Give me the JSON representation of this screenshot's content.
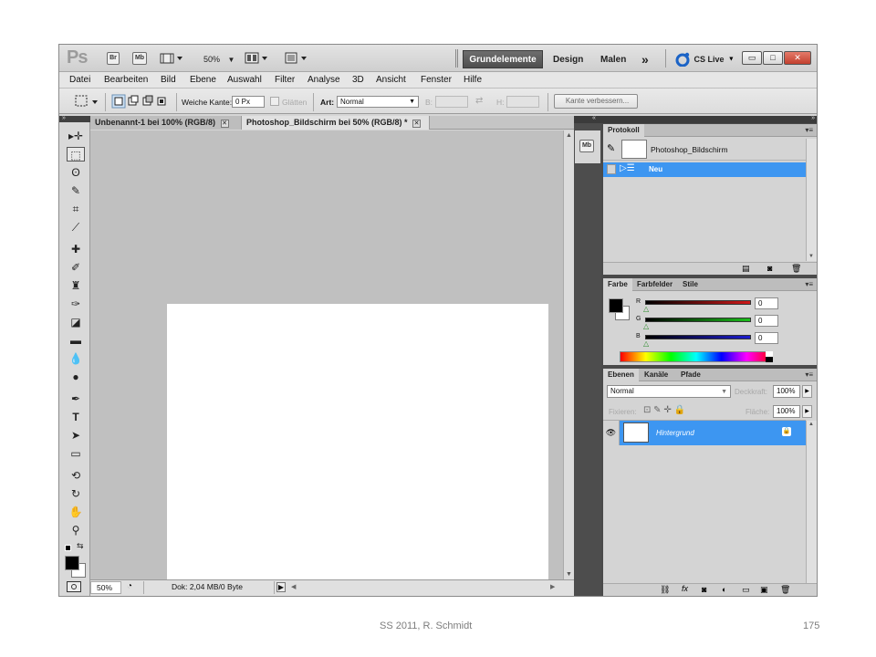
{
  "app": {
    "logo": "Ps",
    "bridge_chip": "Br",
    "minibridge_chip": "Mb",
    "zoom_chip": "50%",
    "workspaces": [
      "Grundelemente",
      "Design",
      "Malen"
    ],
    "more": "»",
    "cs_live": "CS Live",
    "window_buttons": [
      "▭",
      "□",
      "✕"
    ]
  },
  "menu": [
    "Datei",
    "Bearbeiten",
    "Bild",
    "Ebene",
    "Auswahl",
    "Filter",
    "Analyse",
    "3D",
    "Ansicht",
    "Fenster",
    "Hilfe"
  ],
  "options": {
    "feather_label": "Weiche Kante:",
    "feather_value": "0 Px",
    "smooth_label": "Glätten",
    "style_label": "Art:",
    "style_value": "Normal",
    "width_label": "B:",
    "height_label": "H:",
    "refine_button": "Kante verbessern..."
  },
  "documents": {
    "tabs": [
      "Unbenannt-1 bei 100% (RGB/8)",
      "Photoshop_Bildschirm bei 50% (RGB/8) *"
    ],
    "close_glyph": "✕"
  },
  "status": {
    "zoom": "50%",
    "doc_info": "Dok: 2,04 MB/0 Byte"
  },
  "history": {
    "title": "Protokoll",
    "snapshot_name": "Photoshop_Bildschirm",
    "step": "Neu"
  },
  "color": {
    "tabs": [
      "Farbe",
      "Farbfelder",
      "Stile"
    ],
    "channels": [
      {
        "label": "R",
        "value": "0",
        "color": "#d01919"
      },
      {
        "label": "G",
        "value": "0",
        "color": "#1bbf1b"
      },
      {
        "label": "B",
        "value": "0",
        "color": "#1c1cd0"
      }
    ]
  },
  "layers": {
    "tabs": [
      "Ebenen",
      "Kanäle",
      "Pfade"
    ],
    "blend_mode": "Normal",
    "opacity_label": "Deckkraft:",
    "opacity_value": "100%",
    "lock_label": "Fixieren:",
    "fill_label": "Fläche:",
    "fill_value": "100%",
    "layer_name": "Hintergrund"
  },
  "mini_bridge_icon": "Mb",
  "footer": {
    "left": "SS 2011, R. Schmidt",
    "right": "175"
  },
  "colors": {
    "accent": "#3d96f1",
    "workspace_active": "#5a5a5a",
    "canvas_bg": "#c0c0c0"
  }
}
